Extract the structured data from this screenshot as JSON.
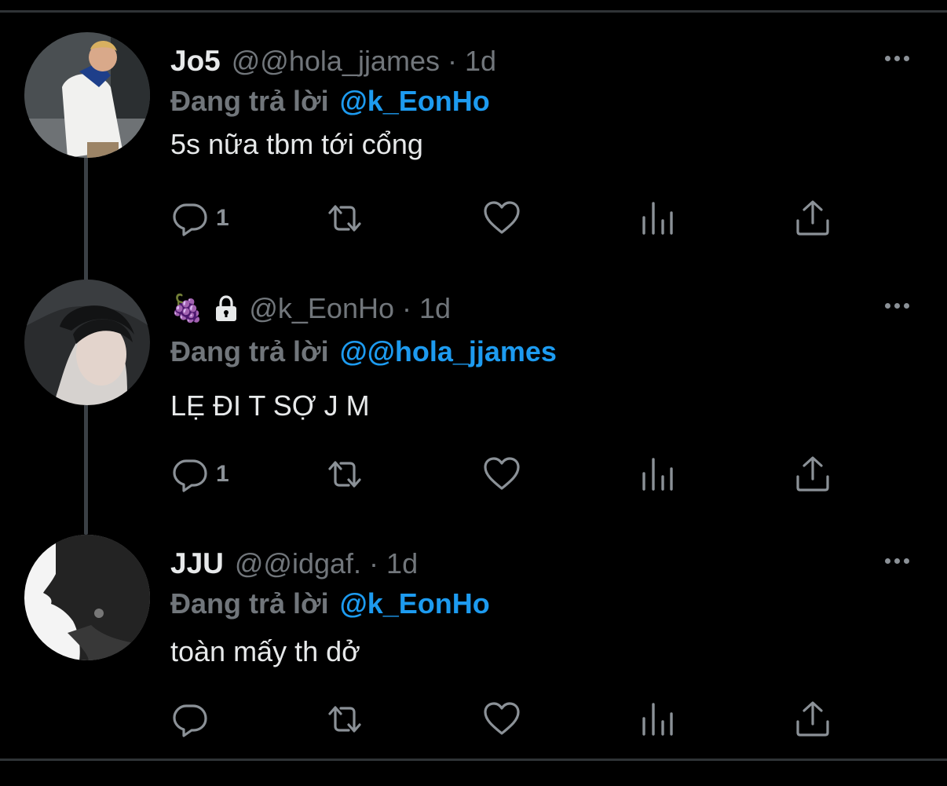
{
  "tweets": [
    {
      "display_name": "Jo5",
      "handle": "@@hola_jjames",
      "separator": "·",
      "time": "1d",
      "reply_label": "Đang trả lời",
      "reply_to": "@k_EonHo",
      "text": "5s nữa tbm tới cổng",
      "reply_count": "1",
      "icons": [
        "reply-icon",
        "retweet-icon",
        "like-icon",
        "analytics-icon",
        "share-icon",
        "more-icon"
      ]
    },
    {
      "display_name_emoji": "🍇",
      "locked": true,
      "handle": "@k_EonHo",
      "separator": "·",
      "time": "1d",
      "reply_label": "Đang trả lời",
      "reply_to": "@@hola_jjames",
      "text": "LẸ ĐI T SỢ J M",
      "reply_count": "1",
      "icons": [
        "reply-icon",
        "retweet-icon",
        "like-icon",
        "analytics-icon",
        "share-icon",
        "more-icon"
      ]
    },
    {
      "display_name": "JJU",
      "handle": "@@idgaf.",
      "separator": "·",
      "time": "1d",
      "reply_label": "Đang trả lời",
      "reply_to": "@k_EonHo",
      "text": "toàn mấy th dở",
      "reply_count": "",
      "icons": [
        "reply-icon",
        "retweet-icon",
        "like-icon",
        "analytics-icon",
        "share-icon",
        "more-icon"
      ]
    }
  ],
  "colors": {
    "background": "#000000",
    "text": "#e7e9ea",
    "muted": "#71767b",
    "accent": "#1d9bf0",
    "divider": "#2f3336"
  }
}
